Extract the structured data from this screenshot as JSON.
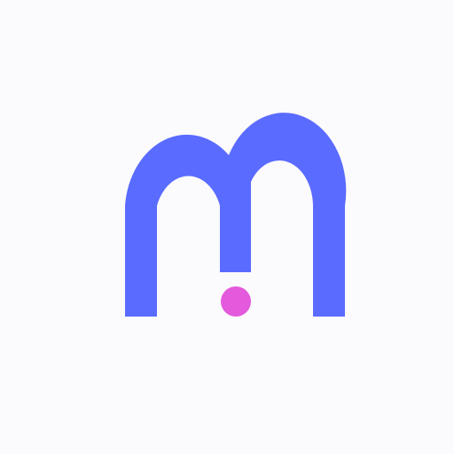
{
  "logo": {
    "name": "m-logo",
    "letter": "m",
    "colors": {
      "background": "#fbfafc",
      "primary": "#5a6bff",
      "accent": "#e35add"
    }
  }
}
